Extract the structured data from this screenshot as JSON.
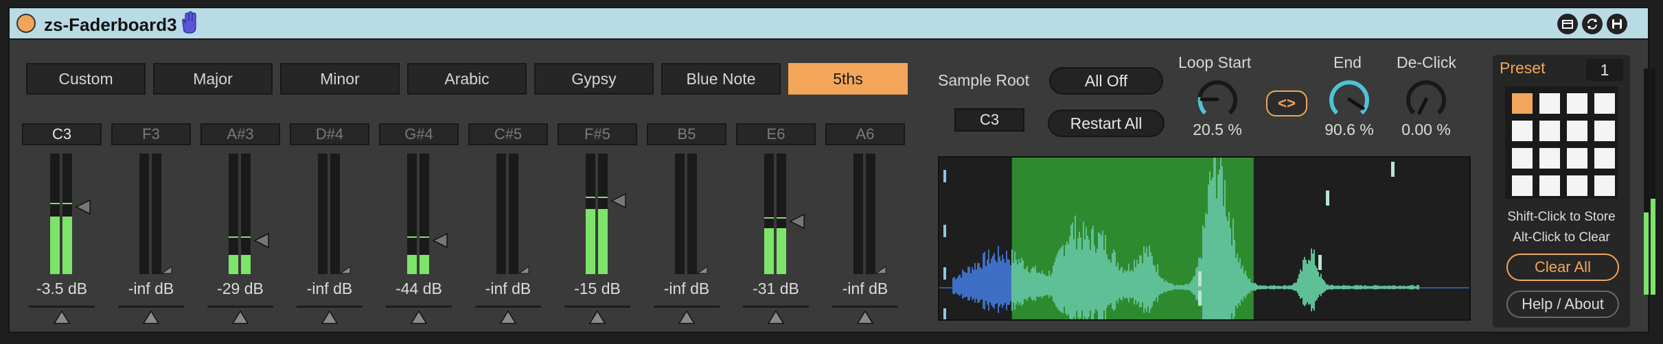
{
  "device": {
    "title": "zs-Faderboard3"
  },
  "scales": [
    {
      "label": "Custom",
      "active": false
    },
    {
      "label": "Major",
      "active": false
    },
    {
      "label": "Minor",
      "active": false
    },
    {
      "label": "Arabic",
      "active": false
    },
    {
      "label": "Gypsy",
      "active": false
    },
    {
      "label": "Blue Note",
      "active": false
    },
    {
      "label": "5ths",
      "active": true
    }
  ],
  "channels": [
    {
      "note": "C3",
      "db": "-3.5 dB",
      "active": true,
      "level": 0.48,
      "peak": 0.58
    },
    {
      "note": "F3",
      "db": "-inf dB",
      "active": false,
      "level": 0,
      "peak": 0
    },
    {
      "note": "A#3",
      "db": "-29 dB",
      "active": false,
      "level": 0.16,
      "peak": 0.3
    },
    {
      "note": "D#4",
      "db": "-inf dB",
      "active": false,
      "level": 0,
      "peak": 0
    },
    {
      "note": "G#4",
      "db": "-44 dB",
      "active": false,
      "level": 0.16,
      "peak": 0.3
    },
    {
      "note": "C#5",
      "db": "-inf dB",
      "active": false,
      "level": 0,
      "peak": 0
    },
    {
      "note": "F#5",
      "db": "-15 dB",
      "active": false,
      "level": 0.54,
      "peak": 0.63
    },
    {
      "note": "B5",
      "db": "-inf dB",
      "active": false,
      "level": 0,
      "peak": 0
    },
    {
      "note": "E6",
      "db": "-31 dB",
      "active": false,
      "level": 0.38,
      "peak": 0.46
    },
    {
      "note": "A6",
      "db": "-inf dB",
      "active": false,
      "level": 0,
      "peak": 0
    }
  ],
  "sample": {
    "root_label": "Sample Root",
    "root_value": "C3",
    "all_off": "All Off",
    "restart_all": "Restart All"
  },
  "loop": {
    "start_label": "Loop Start",
    "start_value": "20.5 %",
    "end_label": "End",
    "end_value": "90.6 %",
    "swap_label": "<>",
    "declick_label": "De-Click",
    "declick_value": "0.00 %"
  },
  "preset": {
    "title": "Preset",
    "number": "1",
    "active_cell": 0,
    "hint_store": "Shift-Click to Store",
    "hint_clear": "Alt-Click to Clear",
    "clear_all": "Clear All",
    "help": "Help / About"
  },
  "colors": {
    "accent": "#f3a65a",
    "meter": "#7de46a",
    "title_bar": "#b8dbe6",
    "wave_loop_bg": "#2e8a2e",
    "wave_loop": "#5fbf96",
    "wave_pre": "#3f6fc4"
  }
}
